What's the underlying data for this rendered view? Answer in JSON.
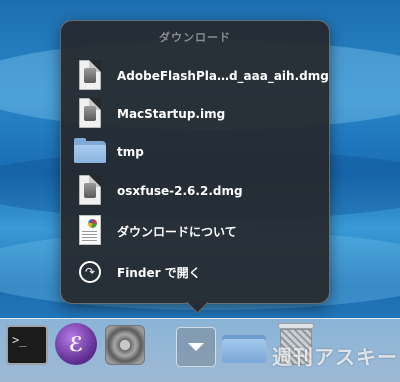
{
  "stack": {
    "title": "ダウンロード",
    "items": [
      {
        "label": "AdobeFlashPla…d_aaa_aih.dmg",
        "icon": "disk-image-icon"
      },
      {
        "label": "MacStartup.img",
        "icon": "disk-image-icon"
      },
      {
        "label": "tmp",
        "icon": "folder-icon"
      },
      {
        "label": "osxfuse-2.6.2.dmg",
        "icon": "disk-image-icon"
      },
      {
        "label": "ダウンロードについて",
        "icon": "document-icon"
      },
      {
        "label": "Finder で開く",
        "icon": "open-arrow-icon"
      }
    ]
  },
  "dock": {
    "items": [
      {
        "name": "terminal-app",
        "icon": "terminal-icon"
      },
      {
        "name": "emacs-app",
        "icon": "emacs-icon"
      },
      {
        "name": "system-preferences-app",
        "icon": "gear-icon"
      },
      {
        "name": "downloads-stack",
        "icon": "chevron-down-icon"
      },
      {
        "name": "documents-folder",
        "icon": "folder-icon"
      },
      {
        "name": "trash",
        "icon": "trash-icon"
      }
    ],
    "terminal_prompt": ">_",
    "emacs_glyph": "ℰ",
    "watermark": "週刊アスキー"
  },
  "colors": {
    "popup_bg": "#26282c",
    "popup_title": "#8a8c90",
    "folder_blue": "#8ab4df"
  }
}
